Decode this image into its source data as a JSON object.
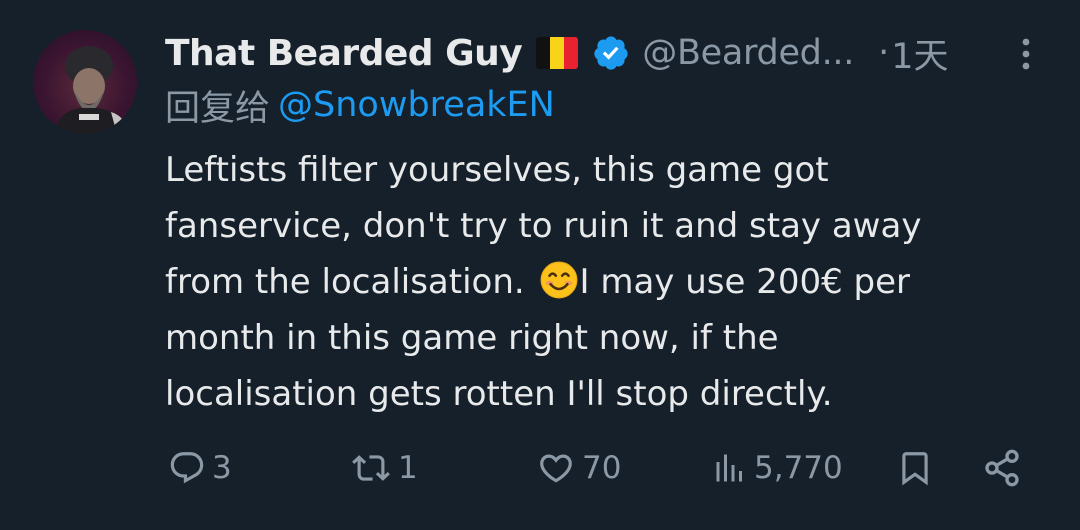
{
  "tweet": {
    "author": {
      "display_name": "That Bearded Guy",
      "flag_icon": "belgium-flag-icon",
      "verified_icon": "verified-badge-icon",
      "handle": "@Bearded...",
      "separator": "·",
      "time": "1天"
    },
    "reply": {
      "prefix": "回复给",
      "target": "@SnowbreakEN"
    },
    "body": {
      "line1": "Leftists filter yourselves, this game got",
      "line2": "fanservice, don't try to ruin it and stay away",
      "line3_before_emoji": "from the localisation. ",
      "line3_emoji": "smiling-face-emoji",
      "line3_after_emoji": "I may use 200€ per",
      "line4": "month in this game right now, if the",
      "line5": "localisation gets rotten I'll stop directly."
    },
    "actions": {
      "replies": "3",
      "retweets": "1",
      "likes": "70",
      "views": "5,770"
    }
  },
  "colors": {
    "background": "#15202b",
    "text_primary": "#e7e9ea",
    "text_secondary": "#8b98a5",
    "accent": "#1d9bf0"
  }
}
